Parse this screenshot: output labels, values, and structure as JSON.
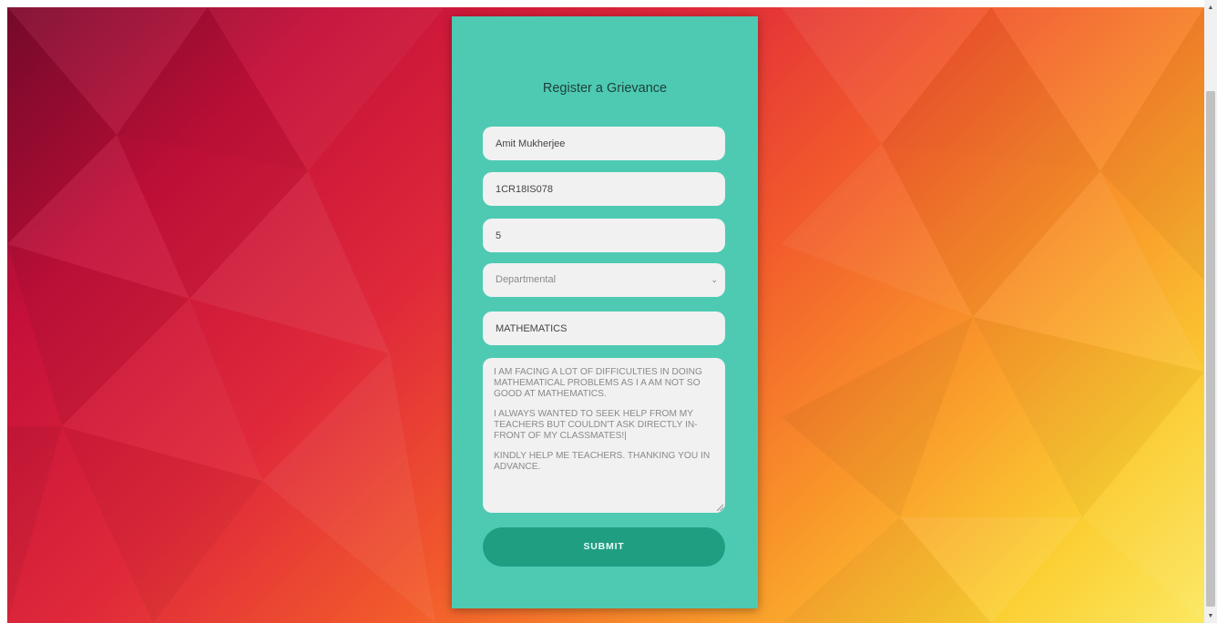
{
  "form": {
    "title": "Register a Grievance",
    "name_value": "Amit Mukherjee",
    "usn_value": "1CR18IS078",
    "semester_value": "5",
    "category_selected": "Departmental",
    "department_value": "MATHEMATICS",
    "message_paragraphs": [
      "I AM FACING A LOT OF DIFFICULTIES IN DOING MATHEMATICAL PROBLEMS AS I A AM NOT SO GOOD AT MATHEMATICS.",
      "I ALWAYS WANTED TO SEEK HELP FROM MY TEACHERS BUT COULDN'T ASK DIRECTLY IN-FRONT OF MY CLASSMATES!|",
      "KINDLY HELP ME TEACHERS. THANKING YOU IN ADVANCE."
    ],
    "submit_label": "SUBMIT"
  },
  "icons": {
    "select_chevron": "chevron-down-icon",
    "scroll_up": "scroll-up-arrow-icon",
    "scroll_down": "scroll-down-arrow-icon"
  },
  "colors": {
    "card_bg": "#4ecab3",
    "button_bg": "#1f9e82",
    "field_bg": "#f1f1f1"
  }
}
